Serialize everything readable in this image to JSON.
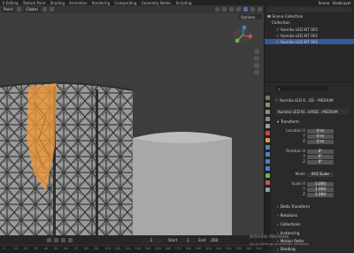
{
  "topbar": {
    "workspaces": [
      "V Editing",
      "Texture Paint",
      "Shading",
      "Animation",
      "Rendering",
      "Compositing",
      "Geometry Nodes",
      "Scripting"
    ],
    "scene": "Scene",
    "view_layer": "ViewLayer"
  },
  "viewport": {
    "mode": "Point",
    "orientation": "Global",
    "options_label": "Options"
  },
  "outliner": {
    "scene_collection": "Scene Collection",
    "collection": "Collection",
    "objects": [
      "Kumiko LED KIT 001",
      "Kumiko LED KIT 001",
      "Kumiko LED KIT 001"
    ]
  },
  "properties": {
    "search_placeholder": "",
    "object_name": "Kumiko LED K...DE - MEDIUM",
    "object_field": "Kumiko LED KI...HADE - MEDIUM",
    "transform_label": "Transform",
    "location_label": "Location X",
    "location": [
      "0 m",
      "0 m",
      "0 m"
    ],
    "rotation_label": "Rotation X",
    "rotation": [
      "0°",
      "0°",
      "0°"
    ],
    "mode_label": "Mode",
    "mode_value": "XYZ Euler",
    "scale_label": "Scale X",
    "scale": [
      "1.000",
      "1.000",
      "1.000"
    ],
    "axis_y": "Y",
    "axis_z": "Z",
    "sections": [
      "Delta Transform",
      "Relations",
      "Collections",
      "Instancing",
      "Motion Paths",
      "Shading"
    ]
  },
  "timeline": {
    "frame": "1",
    "start_label": "Start",
    "start": "1",
    "end_label": "End",
    "end": "250",
    "ruler": [
      "0",
      "10",
      "20",
      "30",
      "40",
      "50",
      "60",
      "70",
      "80",
      "90",
      "100",
      "110",
      "120",
      "130",
      "140",
      "150",
      "160",
      "170",
      "180",
      "190",
      "200",
      "210",
      "220",
      "230",
      "240",
      "250"
    ]
  },
  "watermark": {
    "line1": "Activate Windows",
    "line2": "Go to Settings to activate Windows."
  },
  "colors": {
    "accent": "#4772b3",
    "selection": "#f29a3a",
    "viewport_bg": "#3c3c3c"
  }
}
